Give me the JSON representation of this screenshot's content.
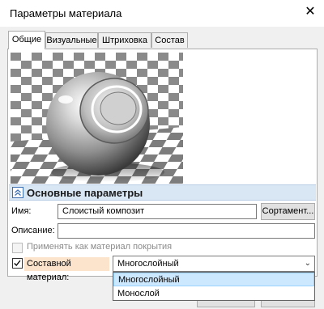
{
  "window": {
    "title": "Параметры материала"
  },
  "tabs": [
    {
      "label": "Общие",
      "active": true
    },
    {
      "label": "Визуальные",
      "active": false
    },
    {
      "label": "Штриховка",
      "active": false
    },
    {
      "label": "Состав",
      "active": false
    }
  ],
  "section": {
    "title": "Основные параметры"
  },
  "form": {
    "name_label": "Имя:",
    "name_value": "Слоистый композит",
    "sortament_button": "Сортамент...",
    "description_label": "Описание:",
    "description_value": "",
    "coating_label": "Применять как материал покрытия",
    "coating_checked": false,
    "coating_enabled": false,
    "composite_label": "Составной материал:",
    "composite_checked": true,
    "composite_value": "Многослойный"
  },
  "dropdown": {
    "options": [
      "Многослойный",
      "Монослой"
    ],
    "selected_index": 0
  },
  "colors": {
    "section_header_bg": "#d9e6f4",
    "highlight_label_bg": "#fbe3cc",
    "dropdown_selected_bg": "#cce8ff"
  },
  "icons": {
    "close": "close-icon",
    "section_toggle": "collapse-chevron-icon",
    "checkmark": "checkmark-icon",
    "combo_arrow": "chevron-down-icon"
  }
}
